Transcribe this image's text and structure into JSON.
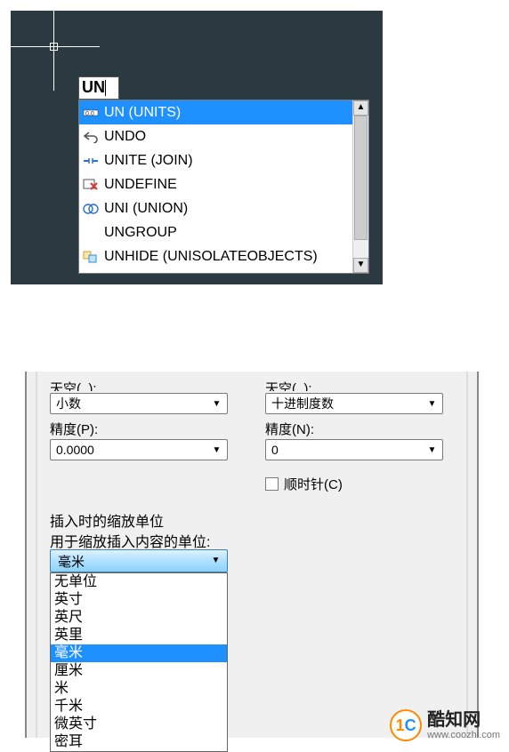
{
  "command_input": "UN",
  "autocomplete": [
    {
      "label": "UN (UNITS)",
      "icon": "dim",
      "selected": true
    },
    {
      "label": "UNDO",
      "icon": "undo",
      "selected": false
    },
    {
      "label": "UNITE (JOIN)",
      "icon": "join",
      "selected": false
    },
    {
      "label": "UNDEFINE",
      "icon": "undef",
      "selected": false
    },
    {
      "label": "UNI (UNION)",
      "icon": "union",
      "selected": false
    },
    {
      "label": "UNGROUP",
      "icon": "",
      "selected": false
    },
    {
      "label": "UNHIDE (UNISOLATEOBJECTS)",
      "icon": "unhide",
      "selected": false
    }
  ],
  "dialog": {
    "left": {
      "cut_label": "天空(_):",
      "type_value": "小数",
      "precision_label": "精度(P):",
      "precision_value": "0.0000"
    },
    "right": {
      "cut_label": "天空(_):",
      "type_value": "十进制度数",
      "precision_label": "精度(N):",
      "precision_value": "0",
      "clockwise_label": "顺时针(C)"
    },
    "insert_section_title": "插入时的缩放单位",
    "insert_section_sub": "用于缩放插入内容的单位:",
    "unit_selected": "毫米",
    "unit_options": [
      "无单位",
      "英寸",
      "英尺",
      "英里",
      "毫米",
      "厘米",
      "米",
      "千米",
      "微英寸",
      "密耳"
    ],
    "unit_highlight_index": 4
  },
  "watermark": {
    "badge_c": "C",
    "title": "酷知网",
    "url": "www.coozhi.com"
  },
  "colors": {
    "highlight": "#1e90ff",
    "cad_bg": "#2b3940"
  }
}
